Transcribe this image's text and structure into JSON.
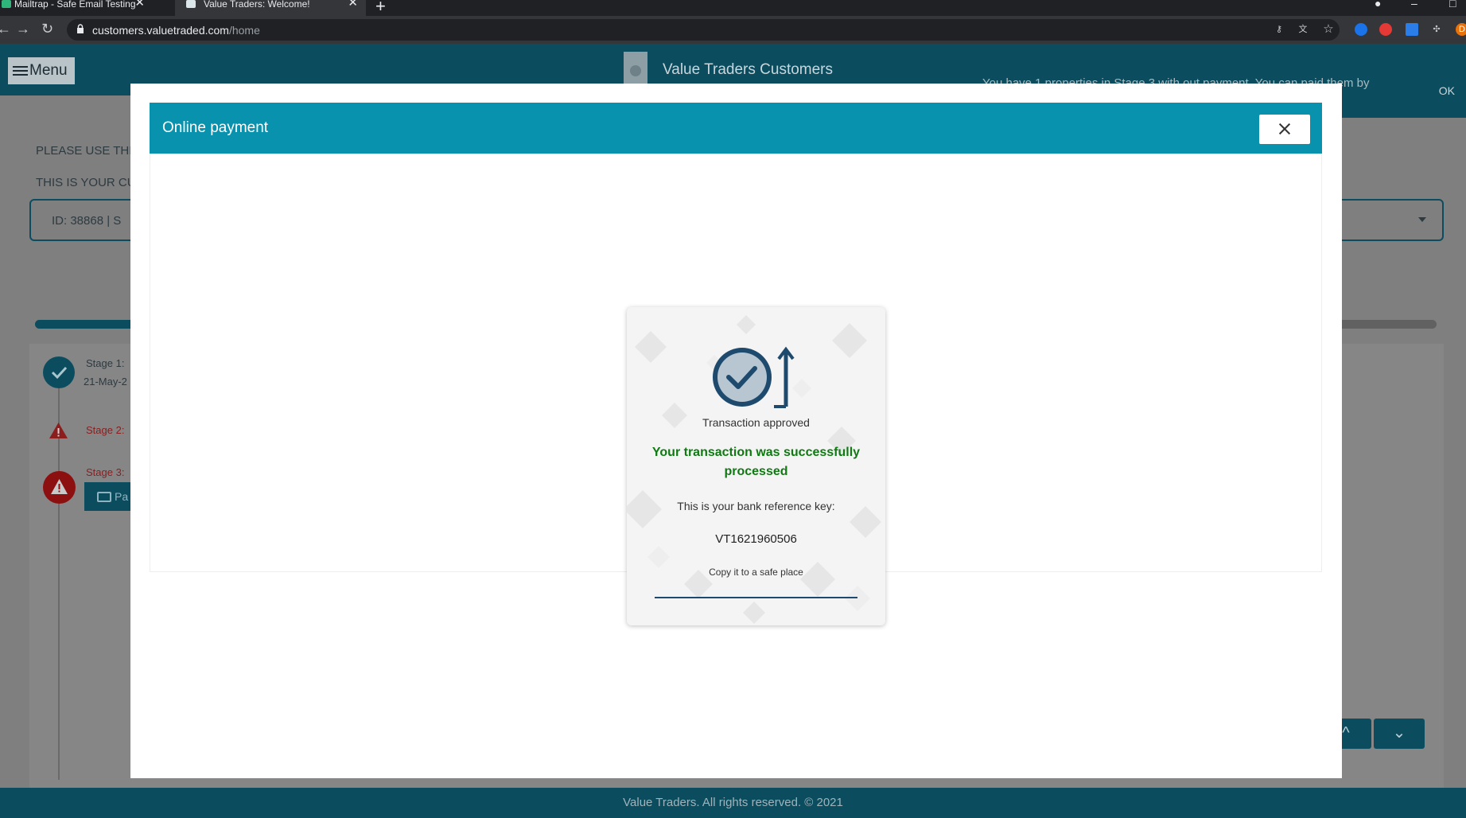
{
  "browser": {
    "tabs": [
      {
        "title": "Mailtrap - Safe Email Testing",
        "close": "✕",
        "active": false
      },
      {
        "title": "Value Traders: Welcome!",
        "close": "✕",
        "active": true
      }
    ],
    "new_tab": "+",
    "url_host": "customers.valuetraded.com",
    "url_path": "/home",
    "profile_initial": "D"
  },
  "app": {
    "menu_label": "Menu",
    "title": "Value Traders Customers",
    "toast": {
      "message": "You have 1 properties in Stage 3 with out payment. You can paid them by",
      "ok_label": "OK"
    },
    "page": {
      "instruction_1": "PLEASE USE THI",
      "instruction_2": "THIS IS YOUR CU",
      "select_value": "ID: 38868  |  S",
      "progress_fraction": 0.34,
      "stages": [
        {
          "label": "Stage 1: ",
          "date": "21-May-2",
          "status": "done"
        },
        {
          "label": "Stage 2: ",
          "status": "warning"
        },
        {
          "label": "Stage 3: ",
          "status": "error"
        }
      ],
      "pay_button": "Pa",
      "scroll_up": "^",
      "scroll_down": "⌄"
    },
    "footer": "Value Traders. All rights reserved. © 2021"
  },
  "modal": {
    "title": "Online payment",
    "receipt": {
      "status": "Transaction approved",
      "success_message": "Your transaction was successfully processed",
      "ref_label": "This is your bank reference key:",
      "ref_key": "VT1621960506",
      "hint": "Copy it to a safe place"
    }
  },
  "colors": {
    "brand_teal": "#0b4d5f",
    "modal_header": "#0992ad",
    "success_green": "#0f7a12",
    "icon_blue": "#1e4a6e"
  },
  "icons": [
    "menu-icon",
    "close-icon",
    "check-circle-icon",
    "arrow-up-icon",
    "warning-icon",
    "credit-card-icon",
    "lock-icon"
  ]
}
